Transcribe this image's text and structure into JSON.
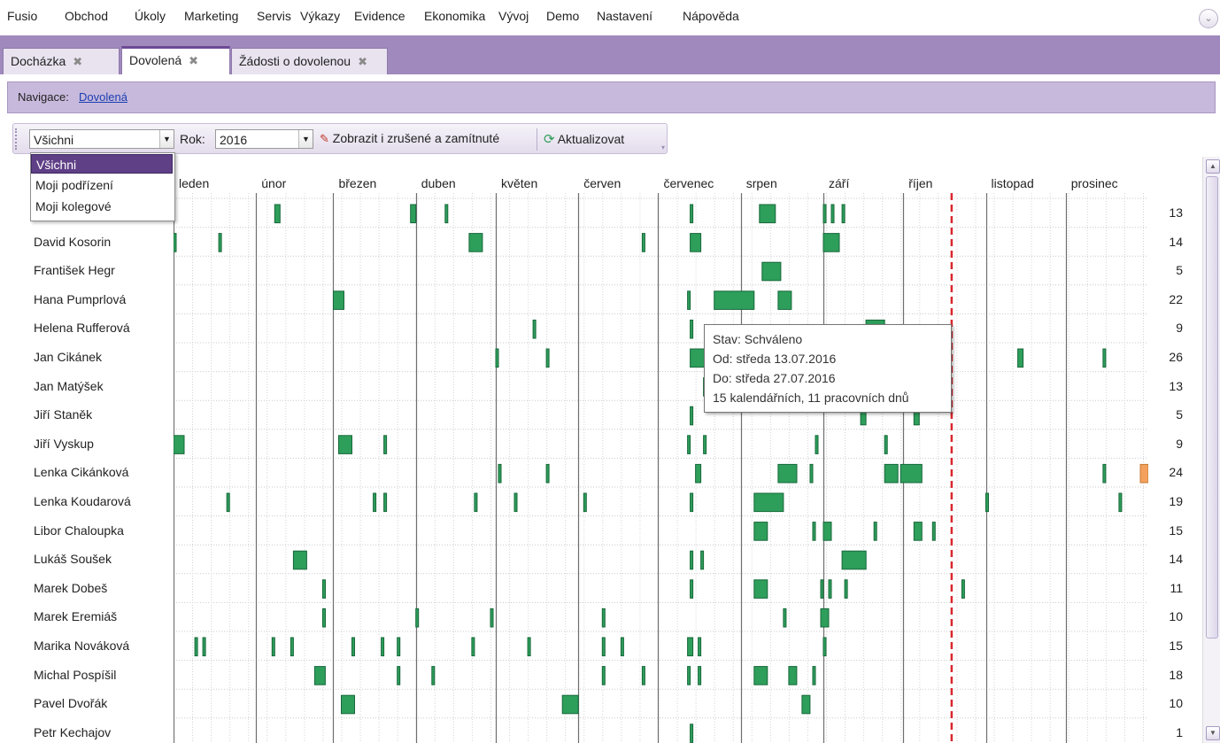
{
  "menu": [
    "Fusio",
    "Obchod",
    "Úkoly",
    "Marketing",
    "Servis",
    "Výkazy",
    "Evidence",
    "Ekonomika",
    "Vývoj",
    "Demo",
    "Nastavení",
    "Nápověda"
  ],
  "tabs": [
    {
      "label": "Docházka",
      "close": "✖",
      "active": false
    },
    {
      "label": "Dovolená",
      "close": "✖",
      "active": true
    },
    {
      "label": "Žádosti o dovolenou",
      "close": "✖",
      "active": false
    }
  ],
  "navigation": {
    "label": "Navigace:",
    "link": "Dovolená"
  },
  "toolbar": {
    "filter_value": "Všichni",
    "year_label": "Rok:",
    "year_value": "2016",
    "show_cancelled_label": "Zobrazit i zrušené a zamítnuté",
    "refresh_label": "Aktualizovat"
  },
  "dropdown_options": [
    "Všichni",
    "Moji podřízení",
    "Moji kolegové"
  ],
  "dropdown_selected": 0,
  "months": [
    "leden",
    "únor",
    "březen",
    "duben",
    "květen",
    "červen",
    "červenec",
    "srpen",
    "září",
    "říjen",
    "listopad",
    "prosinec"
  ],
  "year": 2016,
  "today_marker": "2016-10-19",
  "colors": {
    "approved": "#2e9e5b",
    "approved_border": "#17683a",
    "pending": "#f3a15d",
    "today_line": "#d9272e",
    "tab_strip": "#a089bd"
  },
  "rows": [
    {
      "name": "",
      "days": 13,
      "periods": [
        [
          "02-08",
          "02-09"
        ],
        [
          "03-30",
          "03-31"
        ],
        [
          "04-12",
          "04-12"
        ],
        [
          "07-13",
          "07-13"
        ],
        [
          "08-08",
          "08-13"
        ],
        [
          "09-01",
          "09-01"
        ],
        [
          "09-04",
          "09-04"
        ],
        [
          "09-08",
          "09-08"
        ]
      ]
    },
    {
      "name": "David Kosorin",
      "days": 14,
      "periods": [
        [
          "01-01",
          "01-01"
        ],
        [
          "01-18",
          "01-18"
        ],
        [
          "04-21",
          "04-25"
        ],
        [
          "06-25",
          "06-25"
        ],
        [
          "07-13",
          "07-16"
        ],
        [
          "09-01",
          "09-06"
        ]
      ]
    },
    {
      "name": "František Hegr",
      "days": 5,
      "periods": [
        [
          "08-09",
          "08-15"
        ]
      ]
    },
    {
      "name": "Hana Pumprlová",
      "days": 22,
      "periods": [
        [
          "03-01",
          "03-04"
        ],
        [
          "07-12",
          "07-12"
        ],
        [
          "07-22",
          "08-05"
        ],
        [
          "08-15",
          "08-19"
        ]
      ]
    },
    {
      "name": "Helena Rufferová",
      "days": 9,
      "periods": [
        [
          "05-15",
          "05-15"
        ],
        [
          "07-13",
          "07-13"
        ],
        [
          "09-17",
          "09-23"
        ]
      ]
    },
    {
      "name": "Jan Cikánek",
      "days": 26,
      "periods": [
        [
          "05-01",
          "05-01"
        ],
        [
          "05-20",
          "05-20"
        ],
        [
          "07-13",
          "07-27"
        ],
        [
          "11-13",
          "11-14"
        ],
        [
          "12-15",
          "12-15"
        ]
      ]
    },
    {
      "name": "Jan Matýšek",
      "days": 13,
      "periods": [
        [
          "07-18",
          "07-22"
        ],
        [
          "07-29",
          "07-31"
        ]
      ]
    },
    {
      "name": "Jiří Staněk",
      "days": 5,
      "periods": [
        [
          "07-13",
          "07-13"
        ],
        [
          "09-15",
          "09-16"
        ],
        [
          "10-05",
          "10-06"
        ]
      ]
    },
    {
      "name": "Jiří Vyskup",
      "days": 9,
      "periods": [
        [
          "01-01",
          "01-04"
        ],
        [
          "03-03",
          "03-07"
        ],
        [
          "03-20",
          "03-20"
        ],
        [
          "07-12",
          "07-12"
        ],
        [
          "07-18",
          "07-18"
        ],
        [
          "08-29",
          "08-29"
        ],
        [
          "09-24",
          "09-24"
        ]
      ]
    },
    {
      "name": "Lenka Cikánková",
      "days": 24,
      "periods": [
        [
          "05-02",
          "05-02"
        ],
        [
          "05-20",
          "05-20"
        ],
        [
          "07-15",
          "07-16"
        ],
        [
          "08-15",
          "08-21"
        ],
        [
          "08-27",
          "08-27"
        ],
        [
          "09-24",
          "09-28"
        ],
        [
          "09-30",
          "10-07"
        ],
        [
          "12-15",
          "12-15"
        ],
        [
          "12-29",
          "12-31",
          "pending"
        ]
      ]
    },
    {
      "name": "Lenka Koudarová",
      "days": 19,
      "periods": [
        [
          "01-21",
          "01-21"
        ],
        [
          "03-16",
          "03-16"
        ],
        [
          "03-20",
          "03-20"
        ],
        [
          "04-23",
          "04-23"
        ],
        [
          "05-08",
          "05-08"
        ],
        [
          "06-03",
          "06-03"
        ],
        [
          "07-13",
          "07-13"
        ],
        [
          "08-06",
          "08-16"
        ],
        [
          "11-01",
          "11-01"
        ],
        [
          "12-21",
          "12-21"
        ]
      ]
    },
    {
      "name": "Libor Chaloupka",
      "days": 15,
      "periods": [
        [
          "08-06",
          "08-10"
        ],
        [
          "08-28",
          "08-28"
        ],
        [
          "09-01",
          "09-03"
        ],
        [
          "09-20",
          "09-20"
        ],
        [
          "10-05",
          "10-07"
        ],
        [
          "10-12",
          "10-12"
        ]
      ]
    },
    {
      "name": "Lukáš Soušek",
      "days": 14,
      "periods": [
        [
          "02-15",
          "02-19"
        ],
        [
          "07-13",
          "07-13"
        ],
        [
          "07-17",
          "07-17"
        ],
        [
          "09-08",
          "09-16"
        ]
      ]
    },
    {
      "name": "Marek Dobeš",
      "days": 11,
      "periods": [
        [
          "02-26",
          "02-26"
        ],
        [
          "07-13",
          "07-13"
        ],
        [
          "08-06",
          "08-10"
        ],
        [
          "08-31",
          "08-31"
        ],
        [
          "09-03",
          "09-03"
        ],
        [
          "09-09",
          "09-09"
        ],
        [
          "10-23",
          "10-23"
        ]
      ]
    },
    {
      "name": "Marek Eremiáš",
      "days": 10,
      "periods": [
        [
          "02-26",
          "02-26"
        ],
        [
          "04-01",
          "04-01"
        ],
        [
          "04-29",
          "04-29"
        ],
        [
          "06-10",
          "06-10"
        ],
        [
          "08-17",
          "08-17"
        ],
        [
          "08-31",
          "09-02"
        ]
      ]
    },
    {
      "name": "Marika Nováková",
      "days": 15,
      "periods": [
        [
          "01-09",
          "01-09"
        ],
        [
          "01-12",
          "01-12"
        ],
        [
          "02-07",
          "02-07"
        ],
        [
          "02-14",
          "02-14"
        ],
        [
          "03-08",
          "03-08"
        ],
        [
          "03-19",
          "03-19"
        ],
        [
          "03-25",
          "03-25"
        ],
        [
          "04-22",
          "04-22"
        ],
        [
          "05-13",
          "05-13"
        ],
        [
          "06-10",
          "06-10"
        ],
        [
          "06-17",
          "06-17"
        ],
        [
          "07-12",
          "07-13"
        ],
        [
          "07-16",
          "07-16"
        ],
        [
          "09-01",
          "09-01"
        ]
      ]
    },
    {
      "name": "Michal Pospíšil",
      "days": 18,
      "periods": [
        [
          "02-23",
          "02-26"
        ],
        [
          "03-25",
          "03-25"
        ],
        [
          "04-07",
          "04-07"
        ],
        [
          "06-10",
          "06-10"
        ],
        [
          "06-25",
          "06-25"
        ],
        [
          "07-12",
          "07-12"
        ],
        [
          "07-16",
          "07-16"
        ],
        [
          "08-06",
          "08-10"
        ],
        [
          "08-19",
          "08-21"
        ],
        [
          "08-28",
          "08-28"
        ]
      ]
    },
    {
      "name": "Pavel Dvořák",
      "days": 10,
      "periods": [
        [
          "03-04",
          "03-08"
        ],
        [
          "05-26",
          "05-31"
        ],
        [
          "08-24",
          "08-26"
        ]
      ]
    },
    {
      "name": "Petr Kechajov",
      "days": 1,
      "periods": [
        [
          "07-13",
          "07-13"
        ]
      ]
    }
  ],
  "tooltip": {
    "status": "Stav: Schváleno",
    "from": "Od: středa 13.07.2016",
    "to": "Do: středa 27.07.2016",
    "summary": "15 kalendářních, 11 pracovních dnů"
  }
}
